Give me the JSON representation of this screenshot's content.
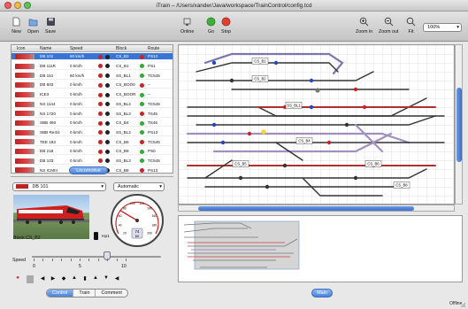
{
  "window": {
    "title": "iTrain – /Users/xander/Java/workspace/TrainControl/config.tcd"
  },
  "toolbar": {
    "new_label": "New",
    "open_label": "Open",
    "save_label": "Save",
    "online_label": "Online",
    "go_label": "Go",
    "stop_label": "Stop",
    "zoom_in_label": "Zoom in",
    "zoom_out_label": "Zoom out",
    "fit_label": "Fit",
    "zoom_value": "100%"
  },
  "table": {
    "headers": {
      "icon": "Icon",
      "name": "Name",
      "speed": "Speed",
      "block": "Block",
      "route": "Route"
    },
    "rows": [
      {
        "name": "DB 101",
        "speed": "60 km/h",
        "block": "CS_B2",
        "route": "PS13"
      },
      {
        "name": "DB 111R",
        "speed": "0 km/h",
        "block": "CS_B1",
        "route": "PS1"
      },
      {
        "name": "DB 151",
        "speed": "60 km/h",
        "block": "SS_BL1",
        "route": "TC545"
      },
      {
        "name": "DB 503",
        "speed": "0 km/h",
        "block": "CS_BOO0",
        "route": "--"
      },
      {
        "name": "ICE3",
        "speed": "0 km/h",
        "block": "CS_BOOR",
        "route": "--"
      },
      {
        "name": "NS 1144",
        "speed": "0 km/h",
        "block": "SS_BL2",
        "route": "TC545"
      },
      {
        "name": "NS 1720",
        "speed": "0 km/h",
        "block": "SS_BL3",
        "route": "TS45"
      },
      {
        "name": "SBB 460",
        "speed": "0 km/h",
        "block": "CS_B4",
        "route": "TS45"
      },
      {
        "name": "SBB Re4/4",
        "speed": "0 km/h",
        "block": "SS_BL2",
        "route": "PS13"
      },
      {
        "name": "TEE 193",
        "speed": "0 km/h",
        "block": "CS_B6",
        "route": "TC545"
      },
      {
        "name": "DB 218",
        "speed": "0 km/h",
        "block": "CS_B6",
        "route": "PS0"
      },
      {
        "name": "DB 103",
        "speed": "0 km/h",
        "block": "SS_BL3",
        "route": "TC545"
      },
      {
        "name": "NS ICMIII",
        "speed": "0 km/h",
        "block": "CS_B8",
        "route": "PS13"
      }
    ]
  },
  "locomotive_button": "Locomotive",
  "control": {
    "selected_loco": "DB 101",
    "mode": "Automatic",
    "block_label": "Block  CS_B2",
    "hp1_label": "Hp1",
    "speed_label": "Speed",
    "slider_min": "0",
    "slider_mid": "5",
    "slider_max": "10",
    "slider_fraction": 0.58,
    "speedometer": {
      "value": "74",
      "unit": "60",
      "ticks": [
        "20",
        "40",
        "60",
        "80",
        "100",
        "120",
        "140",
        "160",
        "180",
        "200"
      ]
    }
  },
  "tabs": [
    "Control",
    "Train",
    "Comment"
  ],
  "layout_labels": [
    "CS_B1",
    "CS_B2",
    "SS_BL1",
    "CS_B4",
    "CS_B5",
    "CS_B6",
    "CS_B8"
  ],
  "main_button": "Main",
  "status": "Offline",
  "colors": {
    "accent": "#3875d7",
    "track": "#333333",
    "route": "#a090c0",
    "occupied": "#cc2222"
  }
}
